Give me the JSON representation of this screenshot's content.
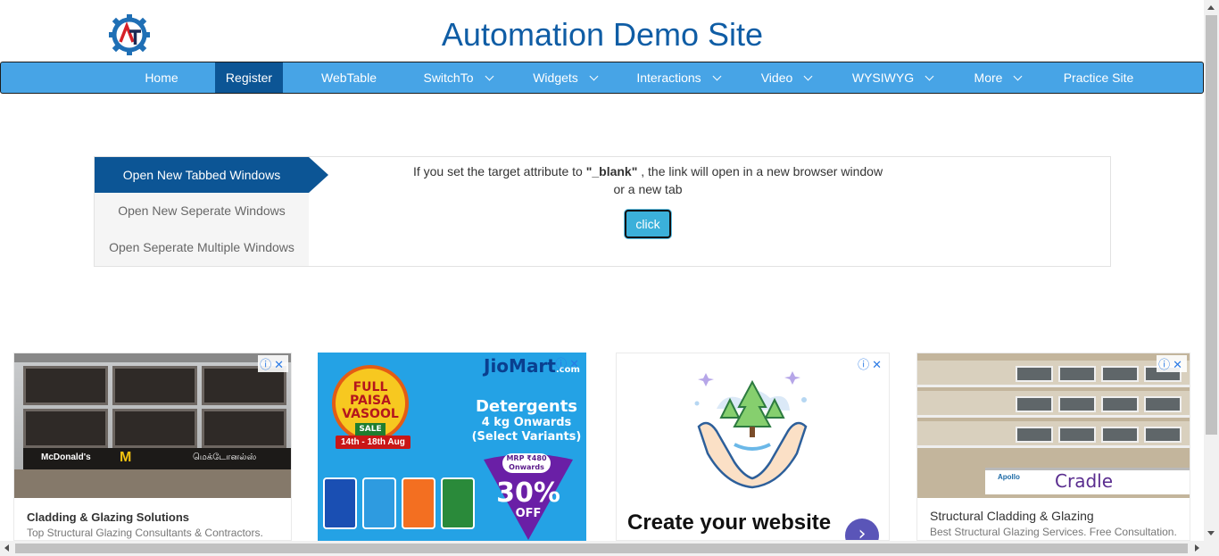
{
  "header": {
    "title": "Automation Demo Site"
  },
  "nav": {
    "items": [
      {
        "label": "Home"
      },
      {
        "label": "Register"
      },
      {
        "label": "WebTable"
      },
      {
        "label": "SwitchTo"
      },
      {
        "label": "Widgets"
      },
      {
        "label": "Interactions"
      },
      {
        "label": "Video"
      },
      {
        "label": "WYSIWYG"
      },
      {
        "label": "More"
      },
      {
        "label": "Practice Site"
      }
    ],
    "active": "Register",
    "colors": {
      "bar": "#47a4e6",
      "active": "#0c5595"
    }
  },
  "windows": {
    "tabs": [
      {
        "label": "Open New Tabbed Windows"
      },
      {
        "label": "Open New Seperate Windows"
      },
      {
        "label": "Open Seperate Multiple Windows"
      }
    ],
    "active_tab": "Open New Tabbed Windows",
    "description_prefix": "If you set the target attribute to ",
    "description_code": "\"_blank\"",
    "description_suffix": " , the link will open in a new browser window",
    "description_line2": "or a new tab",
    "button_label": "click"
  },
  "ads": {
    "ad1": {
      "band_left": "McDonald's",
      "band_right": "மெக்டோனல்ஸ்",
      "headline": "Cladding & Glazing Solutions",
      "description": "Top Structural Glazing Consultants & Contractors. Free Consultation. Quick Quote."
    },
    "ad2": {
      "brand": "JioMart",
      "brand_suffix": ".com",
      "badge_line1": "FULL",
      "badge_line2": "PAISA",
      "badge_line3": "VASOOL",
      "badge_sale": "SALE",
      "dates": "14th - 18th Aug",
      "heading": "Detergents",
      "sub1": "4 kg Onwards",
      "sub2": "(Select Variants)",
      "mrp_line1": "MRP ₹480",
      "mrp_line2": "Onwards",
      "discount": "30%",
      "off": "OFF"
    },
    "ad3": {
      "headline": "Create your website",
      "go_icon": "›"
    },
    "ad4": {
      "sign_brand": "Apollo",
      "sign_name": "Cradle",
      "headline": "Structural Cladding & Glazing",
      "description": "Best Structural Glazing Services. Free Consultation. Fast Delivery."
    },
    "close_glyph": "ⓘ✕"
  }
}
